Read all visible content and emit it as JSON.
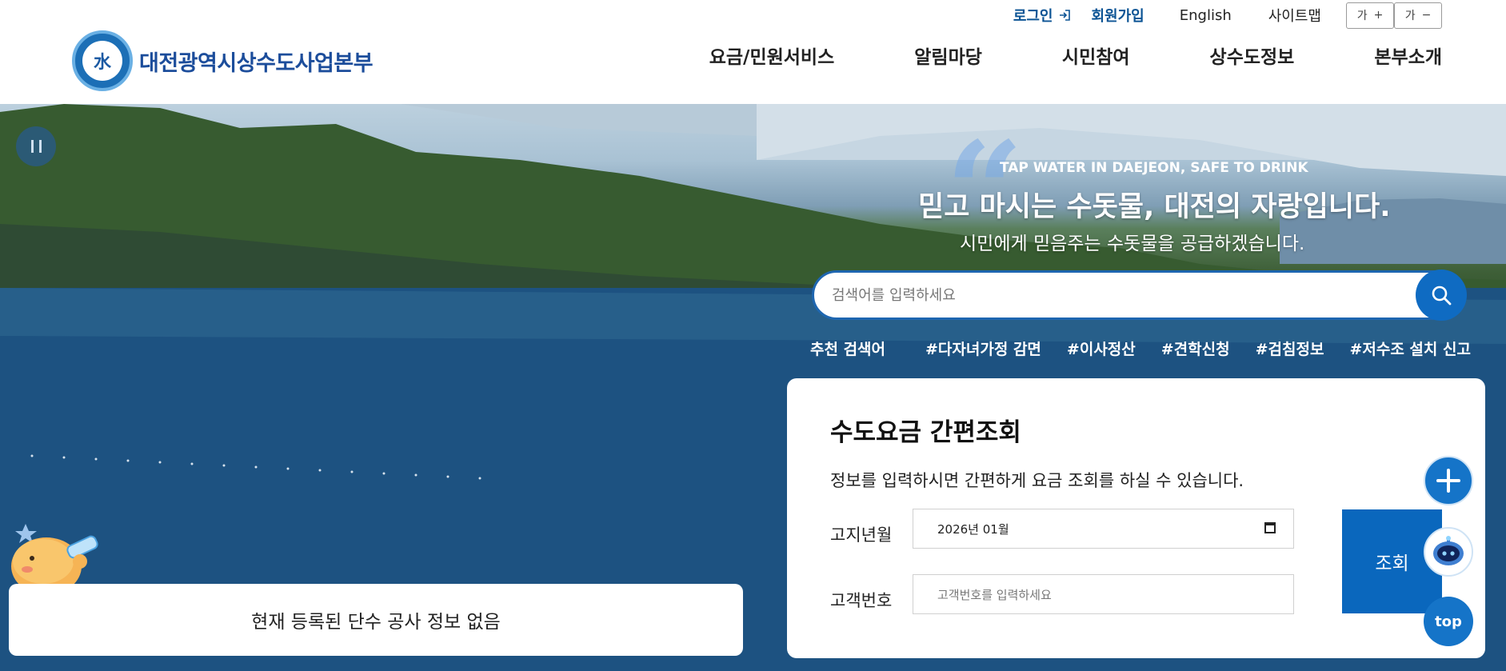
{
  "util": {
    "login": "로그인",
    "join": "회원가입",
    "english": "English",
    "sitemap": "사이트맵",
    "font_up": "가",
    "font_up_sign": "+",
    "font_down": "가",
    "font_down_sign": "−"
  },
  "logo": {
    "mark": "水",
    "text": "대전광역시상수도사업본부"
  },
  "gnb": [
    "요금/민원서비스",
    "알림마당",
    "시민참여",
    "상수도정보",
    "본부소개"
  ],
  "hero": {
    "tagline": "TAP WATER IN DAEJEON, SAFE TO DRINK",
    "headline": "믿고 마시는 수돗물, 대전의 자랑입니다.",
    "subline": "시민에게 믿음주는 수돗물을 공급하겠습니다."
  },
  "search": {
    "placeholder": "검색어를 입력하세요"
  },
  "recommend": {
    "label": "추천 검색어",
    "tags": [
      "#다자녀가정 감면",
      "#이사정산",
      "#견학신청",
      "#검침정보",
      "#저수조 설치 신고"
    ]
  },
  "fee": {
    "title": "수도요금 간편조회",
    "desc": "정보를 입력하시면 간편하게 요금 조회를 하실 수 있습니다.",
    "month_label": "고지년월",
    "month_value": "2026년 01월",
    "customer_label": "고객번호",
    "customer_placeholder": "고객번호를 입력하세요",
    "query": "조회"
  },
  "notice": {
    "text": "현재 등록된 단수 공사 정보 없음"
  },
  "float": {
    "top": "top"
  },
  "colors": {
    "brand": "#1c4d9b",
    "accent": "#0f6bc2"
  }
}
